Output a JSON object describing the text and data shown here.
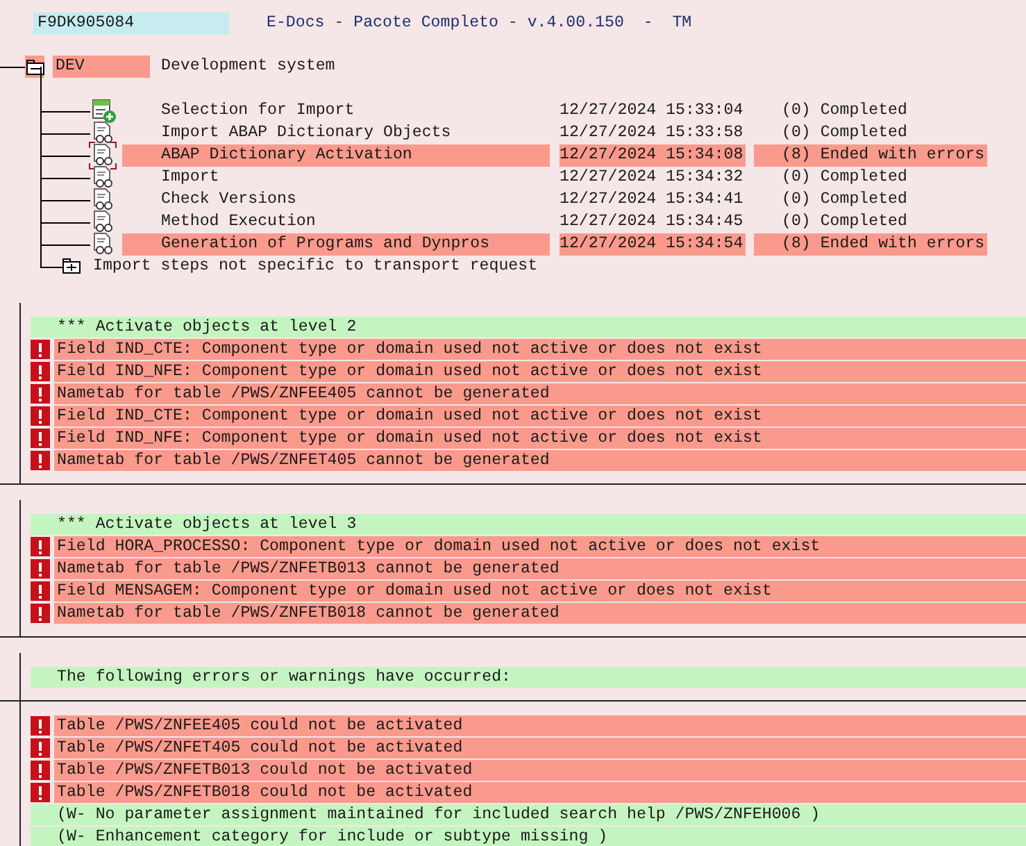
{
  "header": {
    "request": "F9DK905084",
    "title": "E-Docs - Pacote Completo - v.4.00.150  -  TM"
  },
  "system": {
    "name": "DEV",
    "description": "Development system",
    "expanded": true,
    "highlighted": true
  },
  "steps": [
    {
      "kind": "selection",
      "name": "Selection for Import",
      "timestamp": "12/27/2024 15:33:04",
      "status": "(0) Completed",
      "highlighted": false,
      "focused": false
    },
    {
      "kind": "log",
      "name": "Import ABAP Dictionary Objects",
      "timestamp": "12/27/2024 15:33:58",
      "status": "(0) Completed",
      "highlighted": false,
      "focused": false
    },
    {
      "kind": "log",
      "name": "ABAP Dictionary Activation",
      "timestamp": "12/27/2024 15:34:08",
      "status": "(8) Ended with errors",
      "highlighted": true,
      "focused": true
    },
    {
      "kind": "log",
      "name": "Import",
      "timestamp": "12/27/2024 15:34:32",
      "status": "(0) Completed",
      "highlighted": false,
      "focused": false
    },
    {
      "kind": "log",
      "name": "Check Versions",
      "timestamp": "12/27/2024 15:34:41",
      "status": "(0) Completed",
      "highlighted": false,
      "focused": false
    },
    {
      "kind": "log",
      "name": "Method Execution",
      "timestamp": "12/27/2024 15:34:45",
      "status": "(0) Completed",
      "highlighted": false,
      "focused": false
    },
    {
      "kind": "log",
      "name": "Generation of Programs and Dynpros",
      "timestamp": "12/27/2024 15:34:54",
      "status": "(8) Ended with errors",
      "highlighted": true,
      "focused": false
    }
  ],
  "other_steps": {
    "name": "Import steps not specific to transport request",
    "expanded": false
  },
  "log_sections": [
    {
      "lines": [
        {
          "kind": "info",
          "text": "*** Activate objects at level 2"
        },
        {
          "kind": "error",
          "text": "Field IND_CTE: Component type or domain used not active or does not exist"
        },
        {
          "kind": "error",
          "text": "Field IND_NFE: Component type or domain used not active or does not exist"
        },
        {
          "kind": "error",
          "text": "Nametab for table /PWS/ZNFEE405 cannot be generated"
        },
        {
          "kind": "error",
          "text": "Field IND_CTE: Component type or domain used not active or does not exist"
        },
        {
          "kind": "error",
          "text": "Field IND_NFE: Component type or domain used not active or does not exist"
        },
        {
          "kind": "error",
          "text": "Nametab for table /PWS/ZNFET405 cannot be generated"
        }
      ]
    },
    {
      "lines": [
        {
          "kind": "info",
          "text": "*** Activate objects at level 3"
        },
        {
          "kind": "error",
          "text": "Field HORA_PROCESSO: Component type or domain used not active or does not exist"
        },
        {
          "kind": "error",
          "text": "Nametab for table /PWS/ZNFETB013 cannot be generated"
        },
        {
          "kind": "error",
          "text": "Field MENSAGEM: Component type or domain used not active or does not exist"
        },
        {
          "kind": "error",
          "text": "Nametab for table /PWS/ZNFETB018 cannot be generated"
        }
      ]
    },
    {
      "lines": [
        {
          "kind": "info",
          "text": "The following errors or warnings have occurred:"
        }
      ]
    },
    {
      "lines": [
        {
          "kind": "error",
          "text": "Table /PWS/ZNFEE405 could not be activated"
        },
        {
          "kind": "error",
          "text": "Table /PWS/ZNFET405 could not be activated"
        },
        {
          "kind": "error",
          "text": "Table /PWS/ZNFETB013 could not be activated"
        },
        {
          "kind": "error",
          "text": "Table /PWS/ZNFETB018 could not be activated"
        },
        {
          "kind": "info",
          "text": "(W- No parameter assignment maintained for included search help /PWS/ZNFEH006 )"
        },
        {
          "kind": "info",
          "text": "(W- Enhancement category for include or subtype missing )"
        }
      ]
    }
  ]
}
